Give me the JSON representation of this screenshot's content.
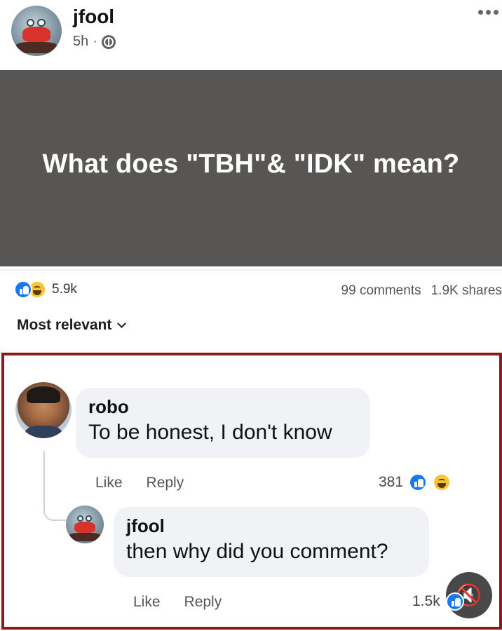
{
  "post": {
    "author": "jfool",
    "time": "5h",
    "separator": "·",
    "image_text": "What does \"TBH\"& \"IDK\" mean?",
    "reactions_count": "5.9k",
    "comments": "99 comments",
    "shares": "1.9K shares"
  },
  "sort_label": "Most relevant",
  "comments": [
    {
      "author": "robo",
      "text": "To be honest, I don't know",
      "like": "Like",
      "reply": "Reply",
      "reactions": "381"
    },
    {
      "author": "jfool",
      "text": "then why did you comment?",
      "like": "Like",
      "reply": "Reply",
      "reactions": "1.5k"
    }
  ],
  "colors": {
    "image_bg": "#575654",
    "frame_border": "#8b1a1a",
    "like_blue": "#1877f2",
    "haha_yellow": "#f7c531",
    "bubble_bg": "#f0f2f5"
  },
  "icons": {
    "privacy": "globe-icon",
    "more": "more-options-icon",
    "mute": "speaker-muted-icon"
  }
}
